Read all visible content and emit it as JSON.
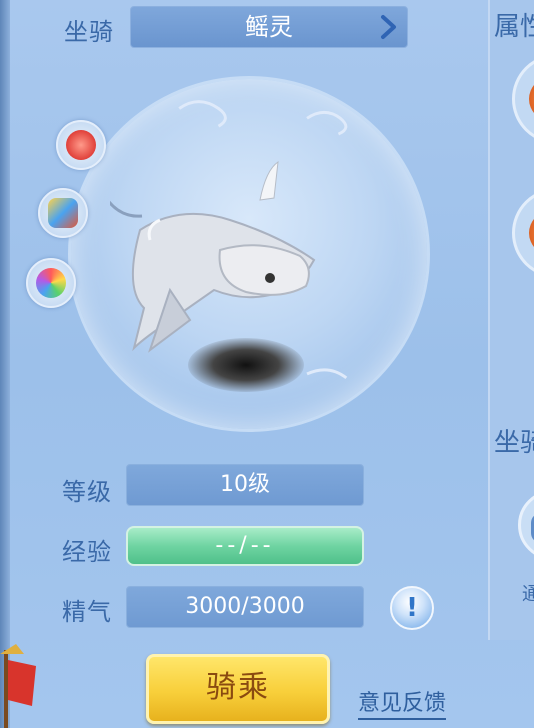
{
  "mount": {
    "label": "坐骑",
    "name": "鳐灵"
  },
  "right_panel": {
    "title_partial": "属性",
    "section_partial": "坐骑",
    "small_text_partial": "通"
  },
  "stats": {
    "level_label": "等级",
    "level_value": "10级",
    "exp_label": "经验",
    "exp_value": "--/--",
    "energy_label": "精气",
    "energy_value": "3000/3000",
    "info_glyph": "!"
  },
  "actions": {
    "ride_label": "骑乘",
    "feedback_label": "意见反馈"
  },
  "side_icons": [
    "fire-skill-icon",
    "treasure-icon",
    "color-palette-icon"
  ],
  "right_icons": [
    "attribute-orb-icon",
    "attribute-orb-icon",
    "mount-skill-icon"
  ],
  "colors": {
    "accent_label": "#3a69a8",
    "ride_button": "#f8cf3a",
    "exp_bar": "#6fd4a2"
  }
}
